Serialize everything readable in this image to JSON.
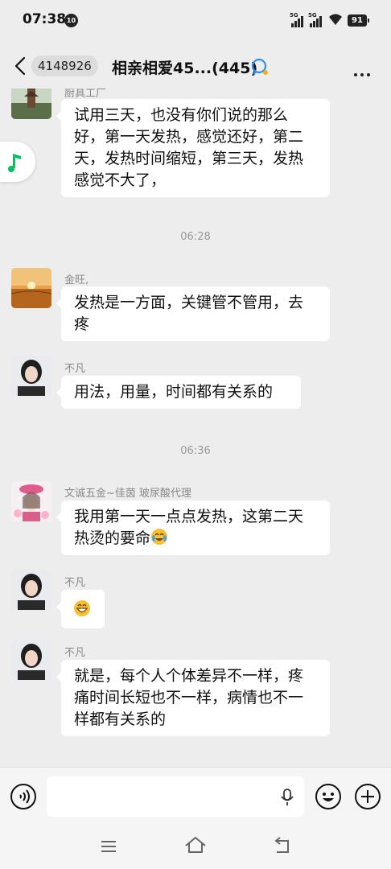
{
  "status_bar": {
    "time": "07:38",
    "badge": "10",
    "network_1": "5G",
    "network_2": "5G",
    "battery": "91"
  },
  "header": {
    "unread_count": "4148926",
    "title": "相亲相爱45...(445)"
  },
  "messages": [
    {
      "sender": "厨具工厂",
      "text": "试用三天，也没有你们说的那么好，第一天发热，感觉还好，第二天，发热时间缩短，第三天，发热感觉不大了，",
      "avatar": "pagoda-scene"
    },
    {
      "divider": "06:28"
    },
    {
      "sender": "金旺,",
      "text": "发热是一方面，关键管不管用，去疼",
      "avatar": "sunset-field"
    },
    {
      "sender": "不凡",
      "text": "用法，用量，时间都有关系的",
      "avatar": "woman-portrait"
    },
    {
      "divider": "06:36"
    },
    {
      "sender": "文诚五金~佳茵  玻尿酸代理",
      "text": "我用第一天一点点发热，这第二天热烫的要命",
      "emoji": "crying-laughing-emoji",
      "avatar": "woman-pink-hat"
    },
    {
      "sender": "不凡",
      "emoji": "grinning-emoji",
      "avatar": "woman-portrait"
    },
    {
      "sender": "不凡",
      "text": "就是，每个人个体差异不一样，疼痛时间长短也不一样，病情也不一样都有关系的",
      "avatar": "woman-portrait"
    }
  ],
  "input": {
    "placeholder": "",
    "value": ""
  },
  "colors": {
    "background": "#ededed",
    "bubble": "#ffffff",
    "music_accent": "#07c160"
  }
}
